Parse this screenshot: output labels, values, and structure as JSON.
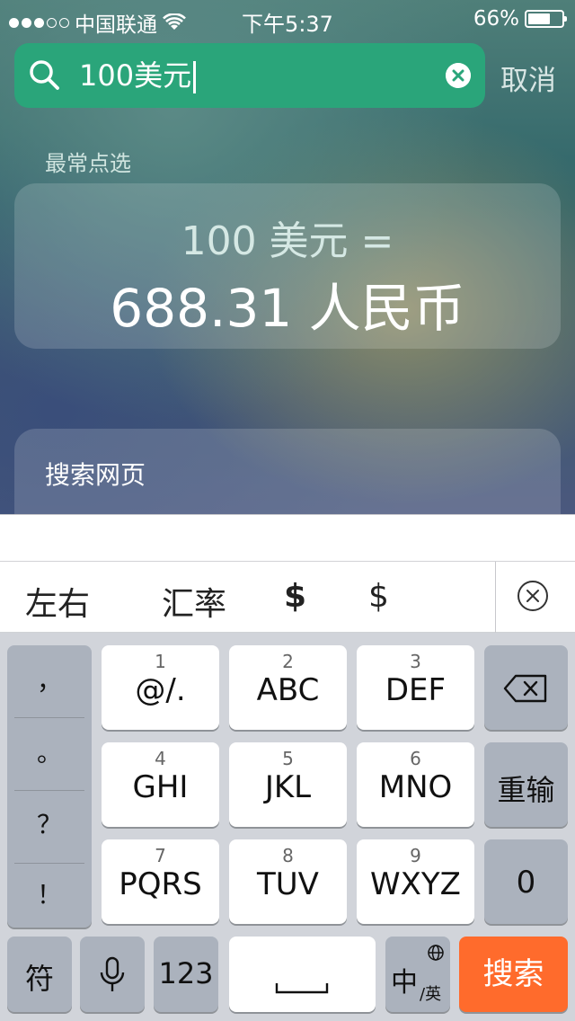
{
  "status_bar": {
    "carrier": "中国联通",
    "time": "下午5:37",
    "battery": "66%",
    "battery_level": 0.66
  },
  "search": {
    "query": "100美元",
    "cancel_label": "取消"
  },
  "top_hit": {
    "section_label": "最常点选",
    "line1": "100 美元 =",
    "line2": "688.31 人民币"
  },
  "web_search": {
    "label": "搜索网页"
  },
  "candidates": [
    "左右",
    "汇率",
    "$",
    "$"
  ],
  "keyboard": {
    "punct": [
      "，",
      "。",
      "？",
      "！"
    ],
    "keys": [
      {
        "num": "1",
        "label": "@/."
      },
      {
        "num": "2",
        "label": "ABC"
      },
      {
        "num": "3",
        "label": "DEF"
      },
      {
        "num": "4",
        "label": "GHI"
      },
      {
        "num": "5",
        "label": "JKL"
      },
      {
        "num": "6",
        "label": "MNO"
      },
      {
        "num": "7",
        "label": "PQRS"
      },
      {
        "num": "8",
        "label": "TUV"
      },
      {
        "num": "9",
        "label": "WXYZ"
      }
    ],
    "reinput": "重输",
    "zero": "0",
    "symbol": "符",
    "num123": "123",
    "lang_main": "中",
    "lang_sub": "/英",
    "search": "搜索"
  },
  "colors": {
    "search_box": "#2aa57a",
    "search_key": "#ff6b2c"
  }
}
